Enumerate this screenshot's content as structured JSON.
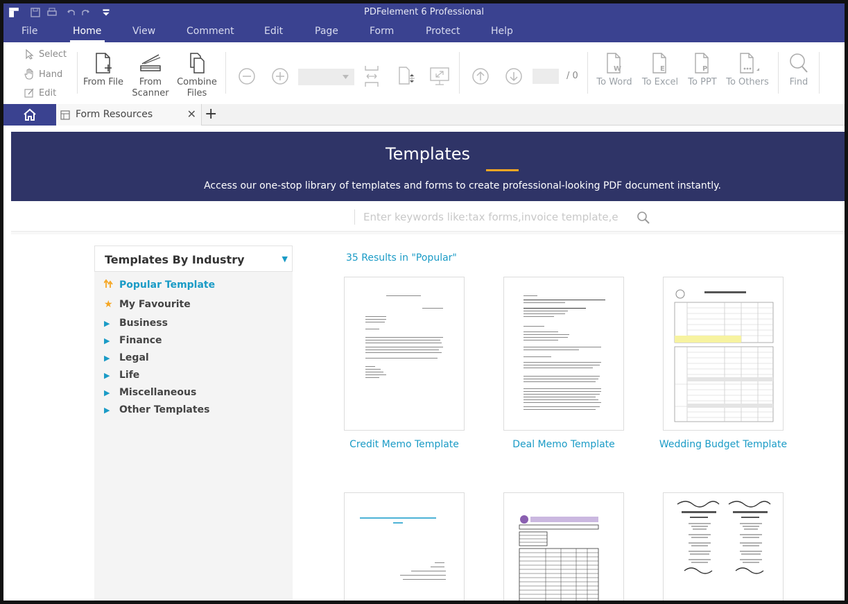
{
  "app": {
    "title": "PDFelement 6 Professional"
  },
  "menu": {
    "items": [
      "File",
      "Home",
      "View",
      "Comment",
      "Edit",
      "Page",
      "Form",
      "Protect",
      "Help"
    ],
    "active": "Home"
  },
  "toolbar": {
    "select_label": "Select",
    "hand_label": "Hand",
    "edit_label": "Edit",
    "from_file_label": "From File",
    "from_scanner_label_1": "From",
    "from_scanner_label_2": "Scanner",
    "combine_label_1": "Combine",
    "combine_label_2": "Files",
    "page_total": "/ 0",
    "to_word_label": "To Word",
    "to_excel_label": "To Excel",
    "to_ppt_label": "To PPT",
    "to_others_label": "To Others",
    "find_label": "Find"
  },
  "tabs": {
    "doc_tab_label": "Form Resources",
    "close_glyph": "✕",
    "add_glyph": "+"
  },
  "banner": {
    "title": "Templates",
    "subtitle": "Access our one-stop library of templates and forms to create professional-looking PDF document instantly.",
    "accent_color": "#f5a623"
  },
  "search": {
    "placeholder": "Enter keywords like:tax forms,invoice template,e"
  },
  "sidebar": {
    "heading": "Templates By Industry",
    "items": [
      {
        "label": "Popular Template",
        "icon": "trending-icon"
      },
      {
        "label": "My Favourite",
        "icon": "star-icon"
      },
      {
        "label": "Business",
        "icon": "caret-right-icon"
      },
      {
        "label": "Finance",
        "icon": "caret-right-icon"
      },
      {
        "label": "Legal",
        "icon": "caret-right-icon"
      },
      {
        "label": "Life",
        "icon": "caret-right-icon"
      },
      {
        "label": "Miscellaneous",
        "icon": "caret-right-icon"
      },
      {
        "label": "Other Templates",
        "icon": "caret-right-icon"
      }
    ]
  },
  "results": {
    "summary": "35  Results in \"Popular\"",
    "cards": [
      {
        "label": "Credit Memo Template"
      },
      {
        "label": "Deal Memo Template"
      },
      {
        "label": "Wedding Budget Template"
      },
      {
        "label": ""
      },
      {
        "label": ""
      },
      {
        "label": ""
      }
    ]
  },
  "colors": {
    "brand": "#3a4290",
    "link": "#1a9bc6",
    "banner": "#2f3467"
  }
}
